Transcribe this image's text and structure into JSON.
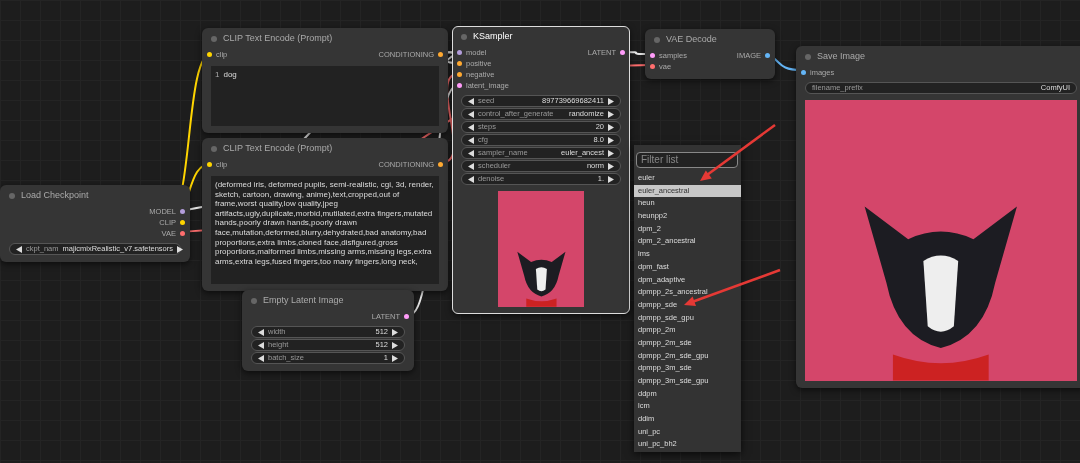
{
  "nodes": [
    {
      "kind": "standard",
      "title": "Load Checkpoint",
      "selected": false,
      "outputs": [
        {
          "name": "MODEL",
          "color": "#b39ddb"
        },
        {
          "name": "CLIP",
          "color": "#ffd500"
        },
        {
          "name": "VAE",
          "color": "#ff6e6e"
        }
      ],
      "widgets": [
        {
          "kind": "stepper",
          "label": "ckpt_nam",
          "value": "majicmixRealistic_v7.safetensors"
        }
      ]
    },
    {
      "kind": "text",
      "title": "CLIP Text Encode (Prompt)",
      "selected": false,
      "inputs": [
        {
          "name": "clip",
          "color": "#ffd500"
        }
      ],
      "outputs": [
        {
          "name": "CONDITIONING",
          "color": "#ffa931"
        }
      ],
      "line_number": "1",
      "text": "dog"
    },
    {
      "kind": "text",
      "title": "CLIP Text Encode (Prompt)",
      "selected": false,
      "inputs": [
        {
          "name": "clip",
          "color": "#ffd500"
        }
      ],
      "outputs": [
        {
          "name": "CONDITIONING",
          "color": "#ffa931"
        }
      ],
      "text": "(deformed iris, deformed pupils, semi-realistic, cgi, 3d, render, sketch, cartoon, drawing, anime),text,cropped,out of frame,worst quality,low quality,jpeg artifacts,ugly,duplicate,morbid,mutilated,extra fingers,mutated hands,poorly drawn hands,poorly drawn face,mutation,deformed,blurry,dehydrated,bad anatomy,bad proportions,extra limbs,cloned face,disfigured,gross proportions,malformed limbs,missing arms,missing legs,extra arms,extra legs,fused fingers,too many fingers,long neck,"
    },
    {
      "kind": "standard",
      "title": "Empty Latent Image",
      "selected": false,
      "outputs": [
        {
          "name": "LATENT",
          "color": "#ff9cf9"
        }
      ],
      "widgets": [
        {
          "kind": "stepper",
          "label": "width",
          "value": "512"
        },
        {
          "kind": "stepper",
          "label": "height",
          "value": "512"
        },
        {
          "kind": "stepper",
          "label": "batch_size",
          "value": "1"
        }
      ]
    },
    {
      "kind": "preview",
      "title": "KSampler",
      "selected": true,
      "inputs": [
        {
          "name": "model",
          "color": "#b39ddb"
        },
        {
          "name": "positive",
          "color": "#ffa931"
        },
        {
          "name": "negative",
          "color": "#ffa931"
        },
        {
          "name": "latent_image",
          "color": "#ff9cf9"
        }
      ],
      "outputs": [
        {
          "name": "LATENT",
          "color": "#ff9cf9"
        }
      ],
      "widgets": [
        {
          "kind": "stepper",
          "label": "seed",
          "value": "897739669682411"
        },
        {
          "kind": "stepper",
          "label": "control_after_generate",
          "value": "randomize"
        },
        {
          "kind": "stepper",
          "label": "steps",
          "value": "20"
        },
        {
          "kind": "stepper",
          "label": "cfg",
          "value": "8.0"
        },
        {
          "kind": "stepper",
          "label": "sampler_name",
          "value": "euler_ancest"
        },
        {
          "kind": "stepper",
          "label": "scheduler",
          "value": "norm"
        },
        {
          "kind": "stepper",
          "label": "denoise",
          "value": "1."
        }
      ]
    },
    {
      "kind": "standard",
      "title": "VAE Decode",
      "selected": false,
      "inputs": [
        {
          "name": "samples",
          "color": "#ff9cf9"
        },
        {
          "name": "vae",
          "color": "#ff6e6e"
        }
      ],
      "outputs": [
        {
          "name": "IMAGE",
          "color": "#64b5f6"
        }
      ]
    },
    {
      "kind": "preview",
      "title": "Save Image",
      "selected": false,
      "inputs": [
        {
          "name": "images",
          "color": "#64b5f6"
        }
      ],
      "widgets": [
        {
          "kind": "text",
          "label": "filename_prefix",
          "value": "ComfyUI"
        }
      ]
    }
  ],
  "dropdown": {
    "placeholder": "Filter list",
    "items": [
      {
        "label": "euler",
        "selected": false
      },
      {
        "label": "euler_ancestral",
        "selected": true
      },
      {
        "label": "heun",
        "selected": false
      },
      {
        "label": "heunpp2",
        "selected": false
      },
      {
        "label": "dpm_2",
        "selected": false
      },
      {
        "label": "dpm_2_ancestral",
        "selected": false
      },
      {
        "label": "lms",
        "selected": false
      },
      {
        "label": "dpm_fast",
        "selected": false
      },
      {
        "label": "dpm_adaptive",
        "selected": false
      },
      {
        "label": "dpmpp_2s_ancestral",
        "selected": false
      },
      {
        "label": "dpmpp_sde",
        "selected": false
      },
      {
        "label": "dpmpp_sde_gpu",
        "selected": false
      },
      {
        "label": "dpmpp_2m",
        "selected": false
      },
      {
        "label": "dpmpp_2m_sde",
        "selected": false
      },
      {
        "label": "dpmpp_2m_sde_gpu",
        "selected": false
      },
      {
        "label": "dpmpp_3m_sde",
        "selected": false
      },
      {
        "label": "dpmpp_3m_sde_gpu",
        "selected": false
      },
      {
        "label": "ddpm",
        "selected": false
      },
      {
        "label": "lcm",
        "selected": false
      },
      {
        "label": "ddim",
        "selected": false
      },
      {
        "label": "uni_pc",
        "selected": false
      },
      {
        "label": "uni_pc_bh2",
        "selected": false
      }
    ]
  }
}
